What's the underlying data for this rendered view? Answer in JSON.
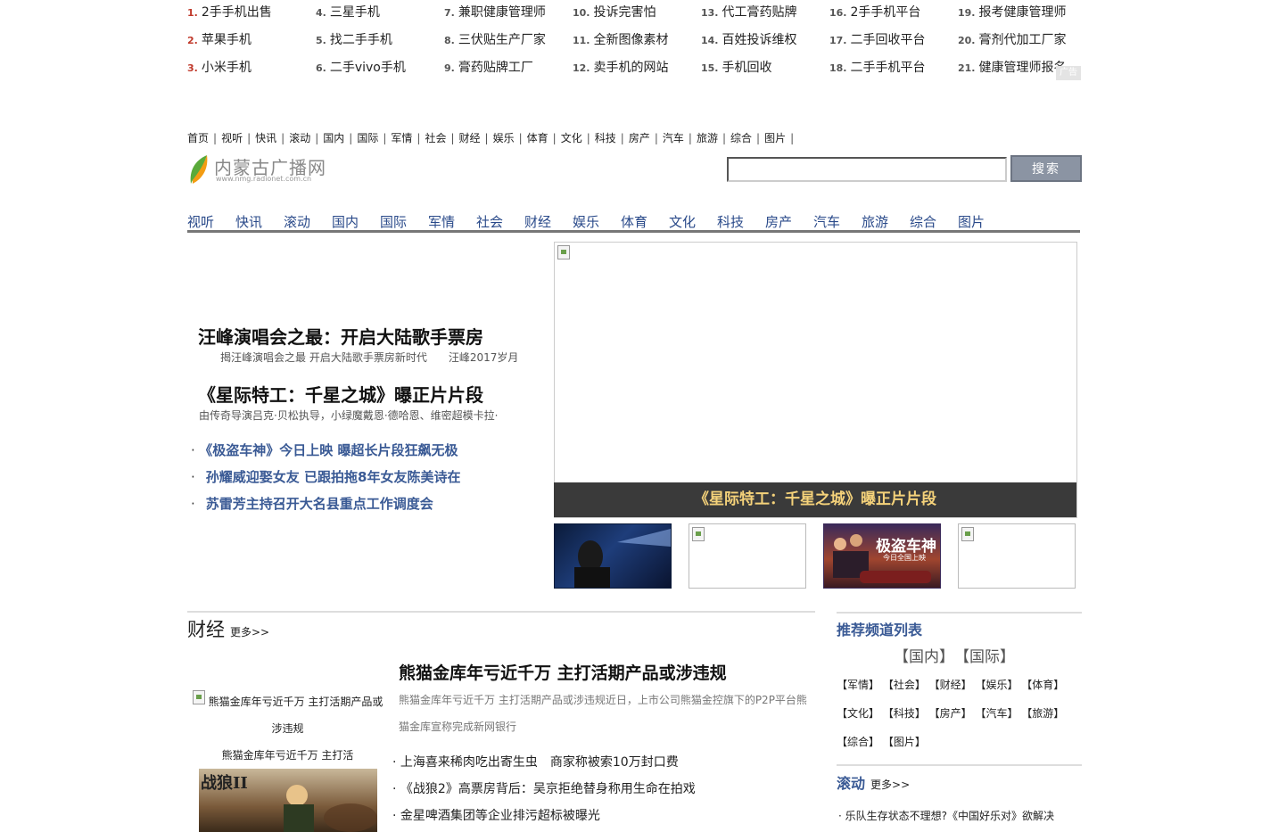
{
  "rank_list": [
    {
      "num": "1.",
      "text": "2手手机出售",
      "hot": true
    },
    {
      "num": "2.",
      "text": "苹果手机",
      "hot": true
    },
    {
      "num": "3.",
      "text": "小米手机",
      "hot": true
    },
    {
      "num": "4.",
      "text": "三星手机",
      "hot": false
    },
    {
      "num": "5.",
      "text": "找二手手机",
      "hot": false
    },
    {
      "num": "6.",
      "text": "二手vivo手机",
      "hot": false
    },
    {
      "num": "7.",
      "text": "兼职健康管理师",
      "hot": false
    },
    {
      "num": "8.",
      "text": "三伏贴生产厂家",
      "hot": false
    },
    {
      "num": "9.",
      "text": "膏药贴牌工厂",
      "hot": false
    },
    {
      "num": "10.",
      "text": "投诉完害怕",
      "hot": false
    },
    {
      "num": "11.",
      "text": "全新图像素材",
      "hot": false
    },
    {
      "num": "12.",
      "text": "卖手机的网站",
      "hot": false
    },
    {
      "num": "13.",
      "text": "代工膏药贴牌",
      "hot": false
    },
    {
      "num": "14.",
      "text": "百姓投诉维权",
      "hot": false
    },
    {
      "num": "15.",
      "text": "手机回收",
      "hot": false
    },
    {
      "num": "16.",
      "text": "2手手机平台",
      "hot": false
    },
    {
      "num": "17.",
      "text": "二手回收平台",
      "hot": false
    },
    {
      "num": "18.",
      "text": "二手手机平台",
      "hot": false
    },
    {
      "num": "19.",
      "text": "报考健康管理师",
      "hot": false
    },
    {
      "num": "20.",
      "text": "膏剂代加工厂家",
      "hot": false
    },
    {
      "num": "21.",
      "text": "健康管理师报名",
      "hot": false
    }
  ],
  "ad_mark": "广告",
  "top_nav": [
    "首页",
    "视听",
    "快讯",
    "滚动",
    "国内",
    "国际",
    "军情",
    "社会",
    "财经",
    "娱乐",
    "体育",
    "文化",
    "科技",
    "房产",
    "汽车",
    "旅游",
    "综合",
    "图片"
  ],
  "logo": {
    "text": "内蒙古广播网",
    "url": "www.nmg.radionet.com.cn"
  },
  "search": {
    "value": "",
    "button": "搜索"
  },
  "channels": [
    "视听",
    "快讯",
    "滚动",
    "国内",
    "国际",
    "军情",
    "社会",
    "财经",
    "娱乐",
    "体育",
    "文化",
    "科技",
    "房产",
    "汽车",
    "旅游",
    "综合",
    "图片"
  ],
  "headlines": [
    {
      "title": "汪峰演唱会之最：开启大陆歌手票房",
      "sub": "揭汪峰演唱会之最 开启大陆歌手票房新时代　　汪峰2017岁月"
    },
    {
      "title": "《星际特工：千星之城》曝正片片段",
      "sub": "由传奇导演吕克·贝松执导，小绿魔戴恩·德哈恩、维密超模卡拉·"
    }
  ],
  "bullets": [
    "《极盗车神》今日上映 曝超长片段狂飙无极",
    "孙耀威迎娶女友 已跟拍拖8年女友陈美诗在",
    "苏雷芳主持召开大名县重点工作调度会"
  ],
  "bullet_dot": "·",
  "slide": {
    "caption": "《星际特工：千星之城》曝正片片段"
  },
  "thumbs": [
    {
      "text": ""
    },
    {
      "text": ""
    },
    {
      "text": "极盗车神",
      "sub": "今日全国上映"
    },
    {
      "text": ""
    }
  ],
  "finance": {
    "title": "财经",
    "more": "更多>>",
    "headline": "熊猫金库年亏近千万 主打活期产品或涉违规",
    "desc": "熊猫金库年亏近千万 主打活期产品或涉违规近日，上市公司熊猫金控旗下的P2P平台熊猫金库宣称完成新网银行",
    "img_alt": "熊猫金库年亏近千万 主打活期产品或涉违规",
    "img_caption": "熊猫金库年亏近千万 主打活",
    "thumb_text": "战狼II",
    "list": [
      "上海喜来稀肉吃出寄生虫　商家称被索10万封口费",
      "《战狼2》高票房背后：吴京拒绝替身称用生命在拍戏",
      "金星啤酒集团等企业排污超标被曝光"
    ],
    "list_dot": "·"
  },
  "sidebar": {
    "rec_title": "推荐频道列表",
    "big_tags": "【国内】　【国际】",
    "tags": "【军情】 【社会】 【财经】 【娱乐】 【体育】 【文化】 【科技】 【房产】 【汽车】 【旅游】 【综合】 【图片】",
    "scroll_title": "滚动",
    "scroll_more": "更多>>",
    "scroll_news": "· 乐队生存状态不理想?《中国好乐对》欲解决"
  }
}
